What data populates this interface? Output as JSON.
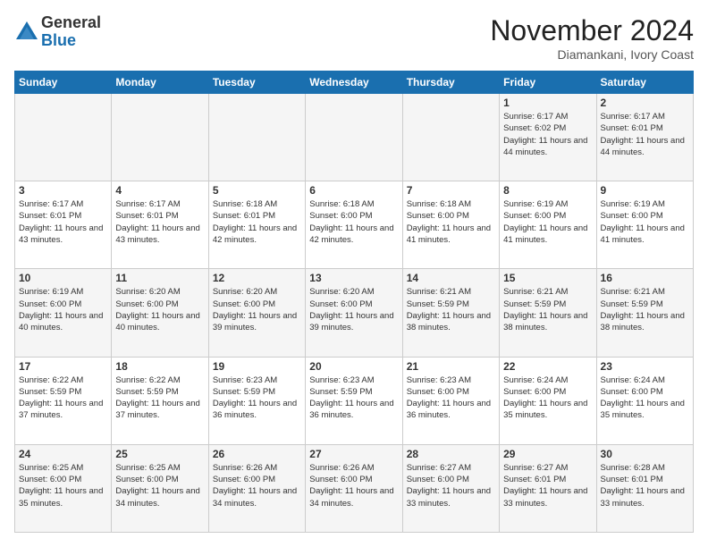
{
  "logo": {
    "general": "General",
    "blue": "Blue"
  },
  "header": {
    "month": "November 2024",
    "location": "Diamankani, Ivory Coast"
  },
  "weekdays": [
    "Sunday",
    "Monday",
    "Tuesday",
    "Wednesday",
    "Thursday",
    "Friday",
    "Saturday"
  ],
  "weeks": [
    [
      {
        "day": "",
        "info": ""
      },
      {
        "day": "",
        "info": ""
      },
      {
        "day": "",
        "info": ""
      },
      {
        "day": "",
        "info": ""
      },
      {
        "day": "",
        "info": ""
      },
      {
        "day": "1",
        "info": "Sunrise: 6:17 AM\nSunset: 6:02 PM\nDaylight: 11 hours and 44 minutes."
      },
      {
        "day": "2",
        "info": "Sunrise: 6:17 AM\nSunset: 6:01 PM\nDaylight: 11 hours and 44 minutes."
      }
    ],
    [
      {
        "day": "3",
        "info": "Sunrise: 6:17 AM\nSunset: 6:01 PM\nDaylight: 11 hours and 43 minutes."
      },
      {
        "day": "4",
        "info": "Sunrise: 6:17 AM\nSunset: 6:01 PM\nDaylight: 11 hours and 43 minutes."
      },
      {
        "day": "5",
        "info": "Sunrise: 6:18 AM\nSunset: 6:01 PM\nDaylight: 11 hours and 42 minutes."
      },
      {
        "day": "6",
        "info": "Sunrise: 6:18 AM\nSunset: 6:00 PM\nDaylight: 11 hours and 42 minutes."
      },
      {
        "day": "7",
        "info": "Sunrise: 6:18 AM\nSunset: 6:00 PM\nDaylight: 11 hours and 41 minutes."
      },
      {
        "day": "8",
        "info": "Sunrise: 6:19 AM\nSunset: 6:00 PM\nDaylight: 11 hours and 41 minutes."
      },
      {
        "day": "9",
        "info": "Sunrise: 6:19 AM\nSunset: 6:00 PM\nDaylight: 11 hours and 41 minutes."
      }
    ],
    [
      {
        "day": "10",
        "info": "Sunrise: 6:19 AM\nSunset: 6:00 PM\nDaylight: 11 hours and 40 minutes."
      },
      {
        "day": "11",
        "info": "Sunrise: 6:20 AM\nSunset: 6:00 PM\nDaylight: 11 hours and 40 minutes."
      },
      {
        "day": "12",
        "info": "Sunrise: 6:20 AM\nSunset: 6:00 PM\nDaylight: 11 hours and 39 minutes."
      },
      {
        "day": "13",
        "info": "Sunrise: 6:20 AM\nSunset: 6:00 PM\nDaylight: 11 hours and 39 minutes."
      },
      {
        "day": "14",
        "info": "Sunrise: 6:21 AM\nSunset: 5:59 PM\nDaylight: 11 hours and 38 minutes."
      },
      {
        "day": "15",
        "info": "Sunrise: 6:21 AM\nSunset: 5:59 PM\nDaylight: 11 hours and 38 minutes."
      },
      {
        "day": "16",
        "info": "Sunrise: 6:21 AM\nSunset: 5:59 PM\nDaylight: 11 hours and 38 minutes."
      }
    ],
    [
      {
        "day": "17",
        "info": "Sunrise: 6:22 AM\nSunset: 5:59 PM\nDaylight: 11 hours and 37 minutes."
      },
      {
        "day": "18",
        "info": "Sunrise: 6:22 AM\nSunset: 5:59 PM\nDaylight: 11 hours and 37 minutes."
      },
      {
        "day": "19",
        "info": "Sunrise: 6:23 AM\nSunset: 5:59 PM\nDaylight: 11 hours and 36 minutes."
      },
      {
        "day": "20",
        "info": "Sunrise: 6:23 AM\nSunset: 5:59 PM\nDaylight: 11 hours and 36 minutes."
      },
      {
        "day": "21",
        "info": "Sunrise: 6:23 AM\nSunset: 6:00 PM\nDaylight: 11 hours and 36 minutes."
      },
      {
        "day": "22",
        "info": "Sunrise: 6:24 AM\nSunset: 6:00 PM\nDaylight: 11 hours and 35 minutes."
      },
      {
        "day": "23",
        "info": "Sunrise: 6:24 AM\nSunset: 6:00 PM\nDaylight: 11 hours and 35 minutes."
      }
    ],
    [
      {
        "day": "24",
        "info": "Sunrise: 6:25 AM\nSunset: 6:00 PM\nDaylight: 11 hours and 35 minutes."
      },
      {
        "day": "25",
        "info": "Sunrise: 6:25 AM\nSunset: 6:00 PM\nDaylight: 11 hours and 34 minutes."
      },
      {
        "day": "26",
        "info": "Sunrise: 6:26 AM\nSunset: 6:00 PM\nDaylight: 11 hours and 34 minutes."
      },
      {
        "day": "27",
        "info": "Sunrise: 6:26 AM\nSunset: 6:00 PM\nDaylight: 11 hours and 34 minutes."
      },
      {
        "day": "28",
        "info": "Sunrise: 6:27 AM\nSunset: 6:00 PM\nDaylight: 11 hours and 33 minutes."
      },
      {
        "day": "29",
        "info": "Sunrise: 6:27 AM\nSunset: 6:01 PM\nDaylight: 11 hours and 33 minutes."
      },
      {
        "day": "30",
        "info": "Sunrise: 6:28 AM\nSunset: 6:01 PM\nDaylight: 11 hours and 33 minutes."
      }
    ]
  ]
}
